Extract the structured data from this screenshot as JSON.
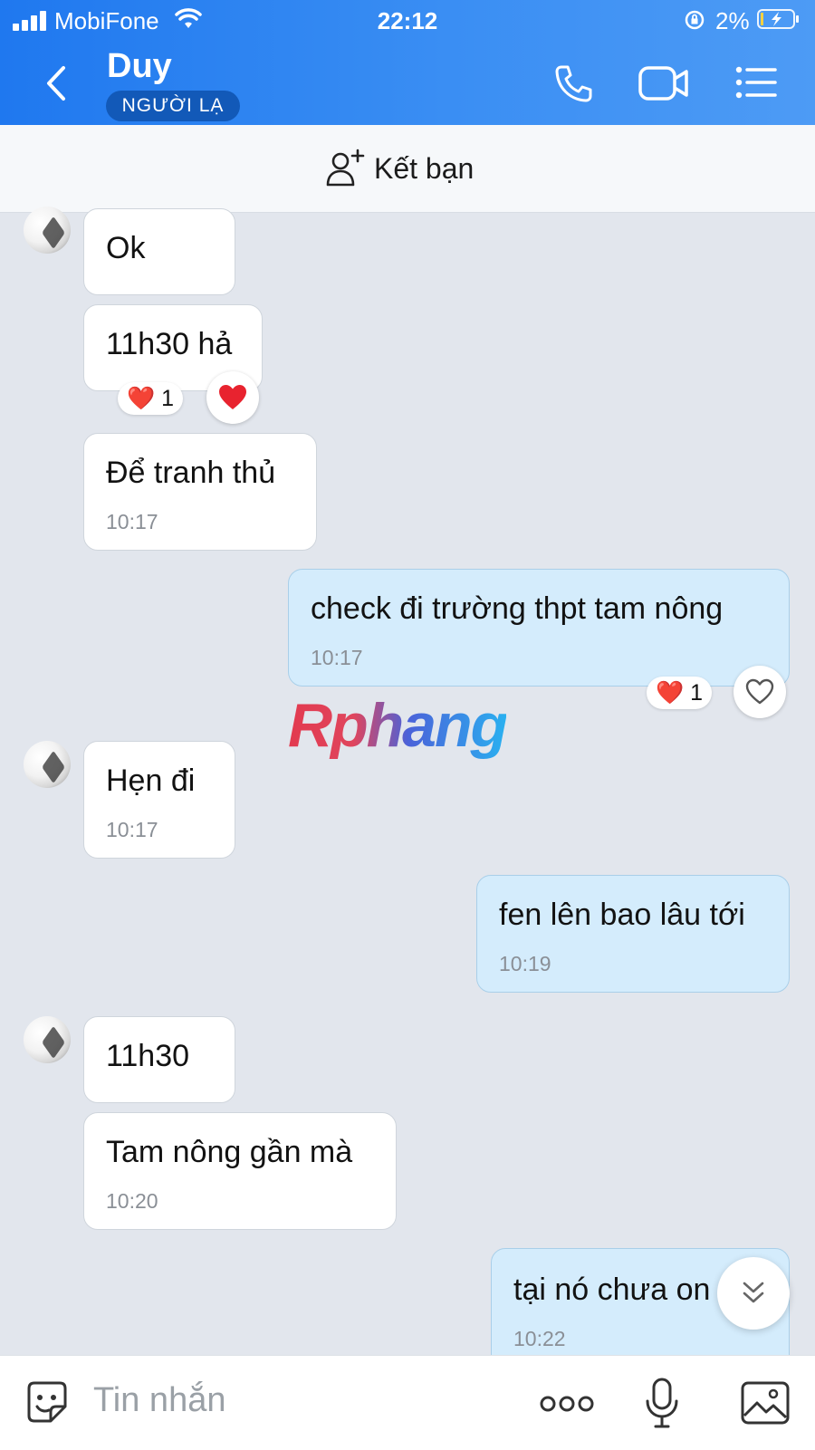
{
  "status_bar": {
    "carrier": "MobiFone",
    "time": "22:12",
    "battery": "2%"
  },
  "header": {
    "title": "Duy",
    "badge": "NGƯỜI LẠ"
  },
  "add_friend": {
    "label": "Kết bạn"
  },
  "messages": [
    {
      "side": "in",
      "text": "Ok"
    },
    {
      "side": "in",
      "text": "11h30 hả",
      "reaction": "❤️",
      "reaction_count": "1"
    },
    {
      "side": "in",
      "text": "Để tranh thủ",
      "time": "10:17"
    },
    {
      "side": "out",
      "text": "check đi trường thpt tam nông",
      "time": "10:17",
      "reaction": "❤️",
      "reaction_count": "1"
    },
    {
      "side": "in",
      "text": "Hẹn đi",
      "time": "10:17"
    },
    {
      "side": "out",
      "text": "fen lên bao lâu tới",
      "time": "10:19"
    },
    {
      "side": "in",
      "text": "11h30"
    },
    {
      "side": "in",
      "text": "Tam nông gần mà",
      "time": "10:20"
    },
    {
      "side": "out",
      "text": "tại nó chưa on",
      "time": "10:22"
    }
  ],
  "watermark": "Rphang",
  "composer": {
    "placeholder": "Tin nhắn"
  },
  "colors": {
    "header_start": "#1f78ef",
    "header_end": "#4d9bf5",
    "outgoing_bubble": "#d4ecfc",
    "incoming_bubble": "#ffffff",
    "chat_background": "#e2e6ed",
    "reaction_heart": "#e8232f"
  }
}
